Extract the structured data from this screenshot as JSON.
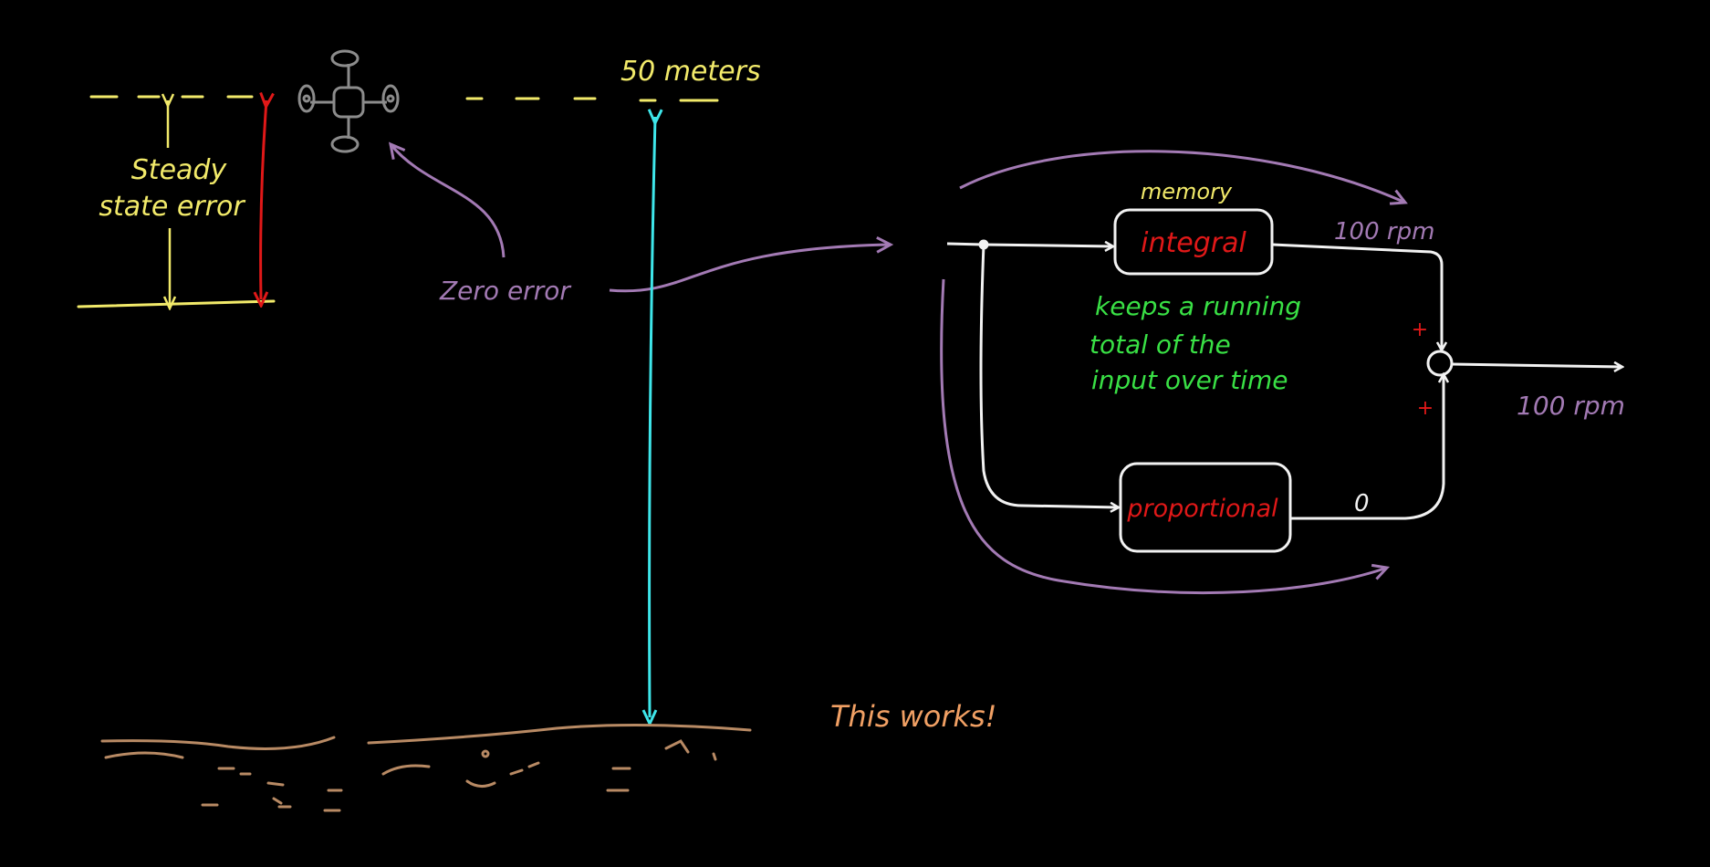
{
  "colors": {
    "background": "#000000",
    "setpoint_yellow": "#f2ea6a",
    "error_red": "#e01818",
    "zero_error_purple": "#a37ab4",
    "distance_cyan": "#3ee6ea",
    "wire_white": "#f2f2f2",
    "note_green": "#39e045",
    "ground_brown": "#b88a64",
    "remark_orange": "#f1a064",
    "drone_gray": "#8c8c8c"
  },
  "labels": {
    "altitude": "50 meters",
    "steady_state_line1": "Steady",
    "steady_state_line2": "state error",
    "zero_error": "Zero error",
    "memory": "memory",
    "integral": "integral",
    "proportional": "proportional",
    "integral_output": "100 rpm",
    "sum_output": "100 rpm",
    "proportional_output": "0",
    "plus_top": "+",
    "plus_bottom": "+",
    "note_line1": "keeps a running",
    "note_line2": "total of the",
    "note_line3": "input over time",
    "remark": "This works!"
  },
  "icons": {
    "drone": "quadcopter-icon"
  }
}
